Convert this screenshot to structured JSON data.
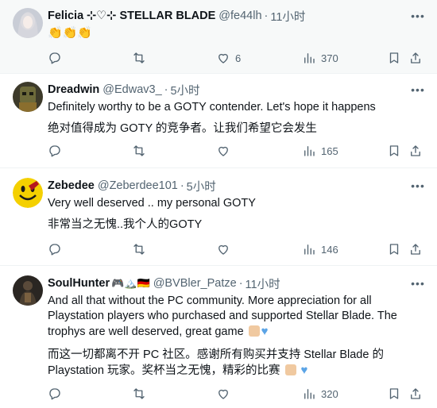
{
  "tweets": [
    {
      "name": "Felicia",
      "name_decor": "⊹♡⊹ STELLAR BLADE",
      "handle": "@fe44lh",
      "time": "11小时",
      "text_lines": [],
      "emoji_text": "👏👏👏",
      "likes": "6",
      "views": "370",
      "avatar_color": "#c9cdd6"
    },
    {
      "name": "Dreadwin",
      "handle": "@Edwav3_",
      "time": "5小时",
      "text_lines": [
        "Definitely worthy to be a GOTY contender. Let's hope it happens",
        "绝对值得成为 GOTY 的竞争者。让我们希望它会发生"
      ],
      "views": "165",
      "avatar_color": "#3d3a2a"
    },
    {
      "name": "Zebedee",
      "handle": "@Zeberdee101",
      "time": "5小时",
      "text_lines": [
        "Very well deserved .. my personal GOTY",
        "非常当之无愧..我个人的GOTY"
      ],
      "views": "146",
      "avatar_color": "#f4d000"
    },
    {
      "name": "SoulHunter",
      "name_decor": "🎮🏔️🇩🇪",
      "handle": "@BVBler_Patze",
      "time": "11小时",
      "text_a": "And all that without the PC community. More appreciation for all Playstation players who purchased and supported Stellar Blade. The trophys are well deserved, great game",
      "text_b": "而这一切都离不开 PC 社区。感谢所有购买并支持 Stellar Blade 的 Playstation 玩家。奖杯当之无愧，精彩的比赛",
      "views": "320",
      "avatar_color": "#2a2622"
    }
  ],
  "colors": {
    "muted": "#536471",
    "divider": "#eff3f4",
    "highlight_bg": "#f7f9f9"
  }
}
